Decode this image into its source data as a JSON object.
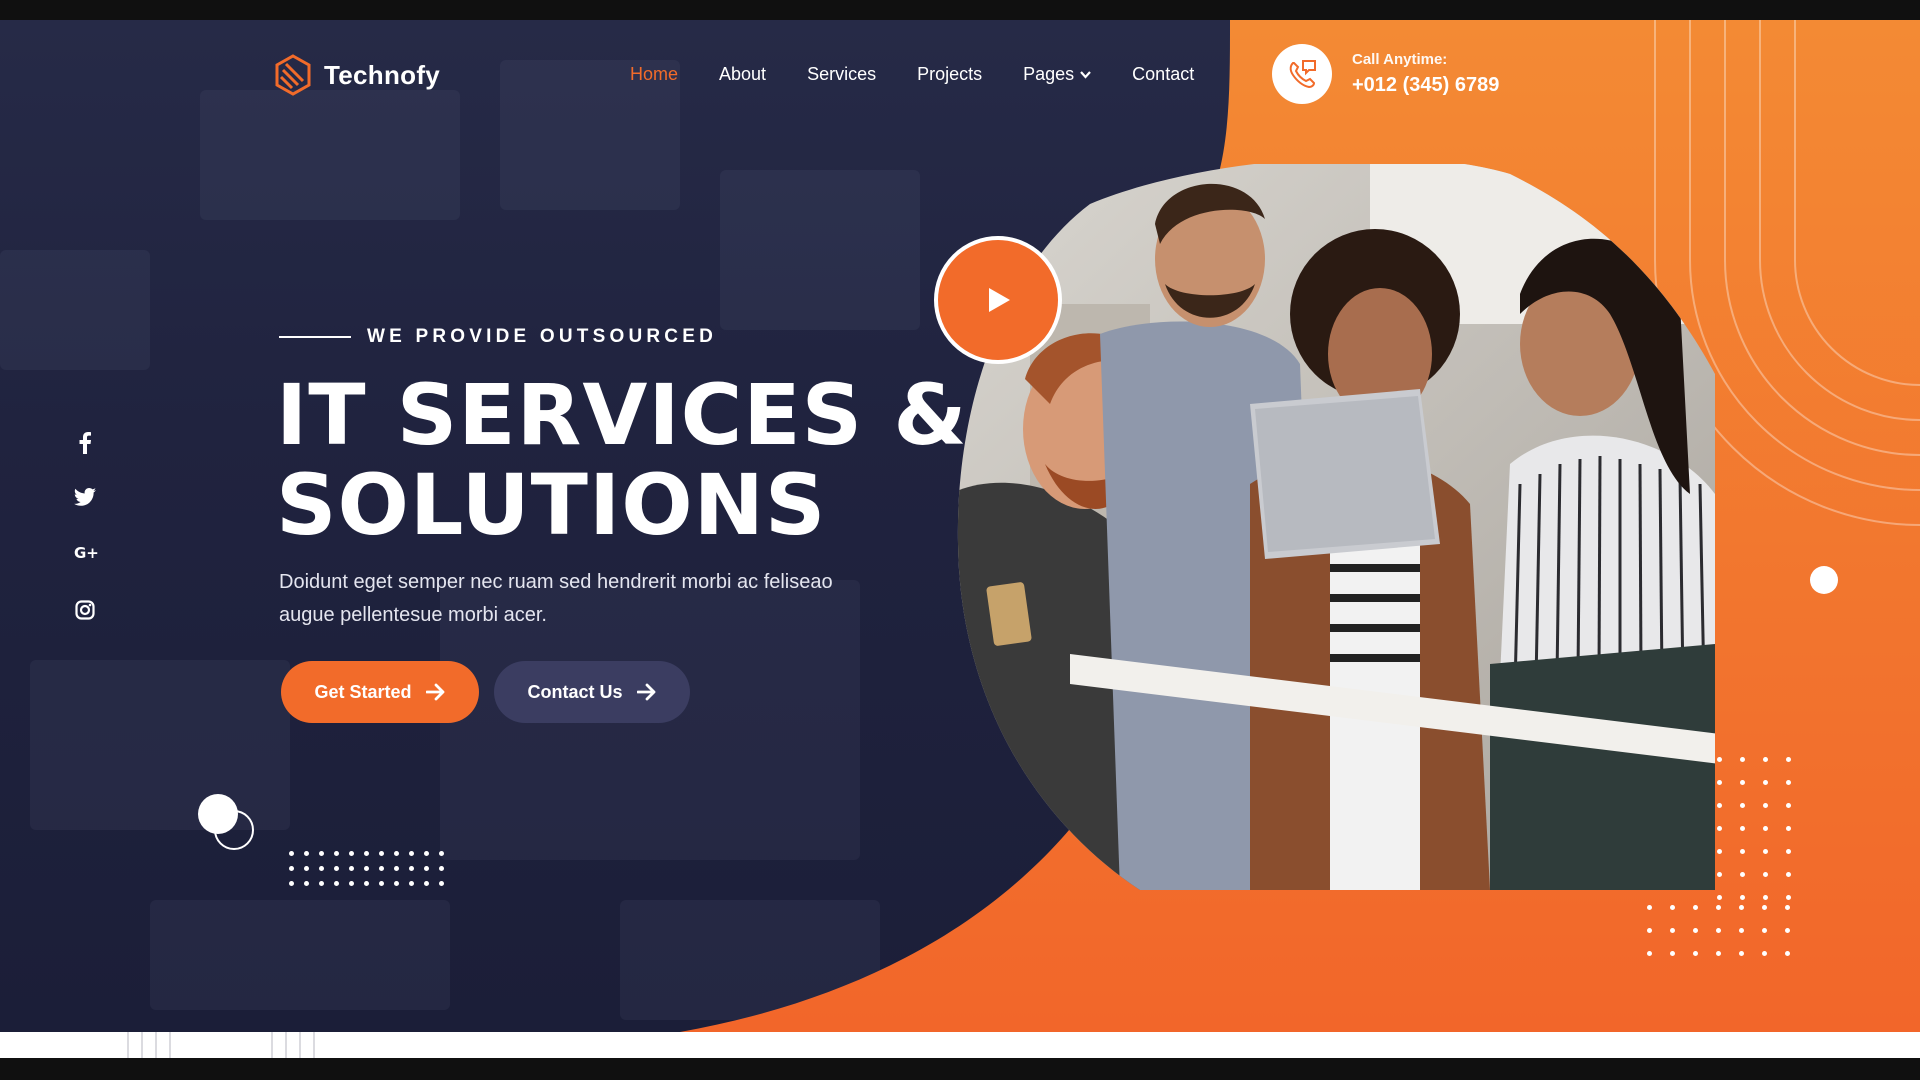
{
  "brand": {
    "name": "Technofy"
  },
  "nav": {
    "items": [
      {
        "label": "Home",
        "active": true
      },
      {
        "label": "About",
        "active": false
      },
      {
        "label": "Services",
        "active": false
      },
      {
        "label": "Projects",
        "active": false
      },
      {
        "label": "Pages",
        "active": false,
        "has_dropdown": true
      },
      {
        "label": "Contact",
        "active": false
      }
    ]
  },
  "call": {
    "label": "Call Anytime:",
    "number": "+012 (345) 6789",
    "icon": "phone-chat-icon"
  },
  "social": [
    {
      "icon": "facebook-icon",
      "glyph": "f"
    },
    {
      "icon": "twitter-icon",
      "glyph": "🐦"
    },
    {
      "icon": "google-plus-icon",
      "glyph": "G+"
    },
    {
      "icon": "instagram-icon",
      "glyph": "◎"
    }
  ],
  "hero": {
    "eyebrow": "WE PROVIDE OUTSOURCED",
    "headline_line1": "IT SERVICES &",
    "headline_line2": "SOLUTIONS",
    "description": "Doidunt eget semper nec ruam sed hendrerit morbi ac feliseao augue pellentesue morbi acer.",
    "primary_button": "Get Started",
    "secondary_button": "Contact Us"
  },
  "colors": {
    "accent": "#f26b2a",
    "dark": "#1b1d3a",
    "button_secondary": "#3b3d61"
  }
}
